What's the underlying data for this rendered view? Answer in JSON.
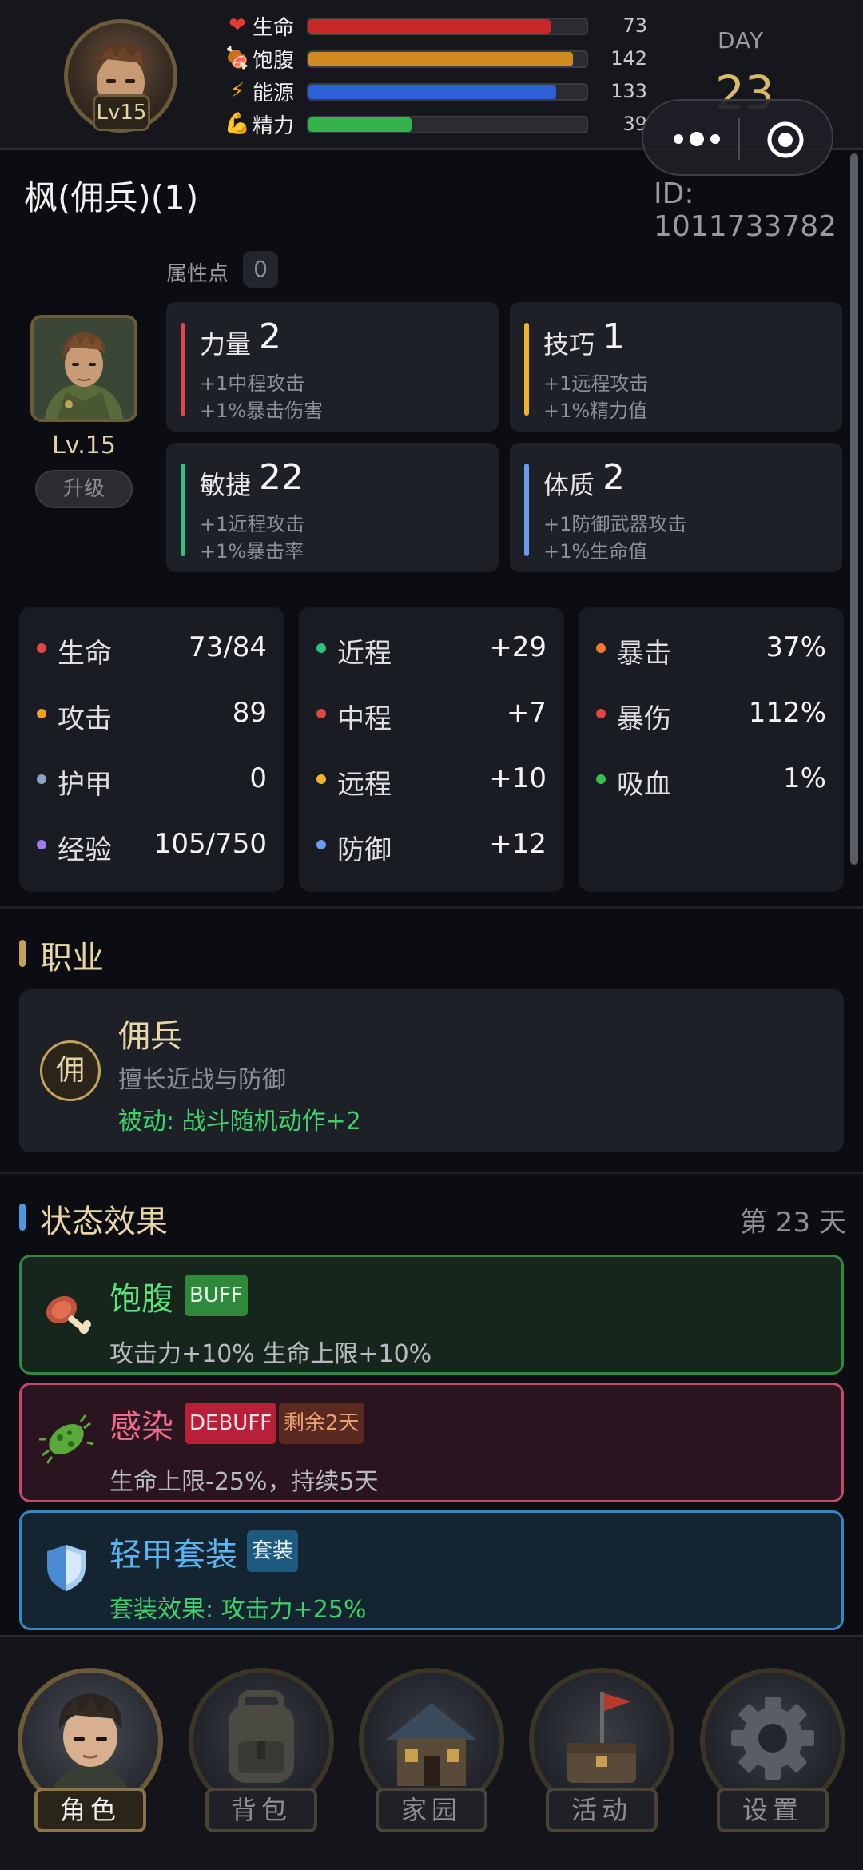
{
  "header": {
    "level_badge": "Lv15",
    "stats": [
      {
        "icon": "heart-icon",
        "glyph": "❤",
        "label": "生命",
        "value": "73",
        "fill": 0.87,
        "color": "#c62828"
      },
      {
        "icon": "meat-icon",
        "glyph": "🍖",
        "label": "饱腹",
        "value": "142",
        "fill": 0.95,
        "color": "#d08a1f"
      },
      {
        "icon": "lightning-icon",
        "glyph": "⚡",
        "label": "能源",
        "value": "133",
        "fill": 0.89,
        "color": "#2d5fd6"
      },
      {
        "icon": "muscle-icon",
        "glyph": "💪",
        "label": "精力",
        "value": "39",
        "fill": 0.37,
        "color": "#34b34a"
      }
    ],
    "day_label": "DAY",
    "day_number": "23"
  },
  "character": {
    "name": "枫(佣兵)(1)",
    "id": "ID: 1011733782",
    "attr_points_label": "属性点",
    "attr_points_value": "0",
    "level": "Lv.15",
    "upgrade_label": "升级"
  },
  "attributes": [
    {
      "name": "力量",
      "value": "2",
      "desc1": "+1中程攻击",
      "desc2": "+1%暴击伤害",
      "color": "#e04848"
    },
    {
      "name": "技巧",
      "value": "1",
      "desc1": "+1远程攻击",
      "desc2": "+1%精力值",
      "color": "#f0b429"
    },
    {
      "name": "敏捷",
      "value": "22",
      "desc1": "+1近程攻击",
      "desc2": "+1%暴击率",
      "color": "#2ec27e"
    },
    {
      "name": "体质",
      "value": "2",
      "desc1": "+1防御武器攻击",
      "desc2": "+1%生命值",
      "color": "#6a9cf0"
    }
  ],
  "stats_panels": [
    [
      {
        "name": "生命",
        "value": "73/84",
        "color": "#e04848"
      },
      {
        "name": "攻击",
        "value": "89",
        "color": "#f0a020"
      },
      {
        "name": "护甲",
        "value": "0",
        "color": "#8aa4c8"
      },
      {
        "name": "经验",
        "value": "105/750",
        "color": "#a07cf0"
      }
    ],
    [
      {
        "name": "近程",
        "value": "+29",
        "color": "#2ec27e"
      },
      {
        "name": "中程",
        "value": "+7",
        "color": "#e04848"
      },
      {
        "name": "远程",
        "value": "+10",
        "color": "#f0b429"
      },
      {
        "name": "防御",
        "value": "+12",
        "color": "#6a9cf0"
      }
    ],
    [
      {
        "name": "暴击",
        "value": "37%",
        "color": "#f07830"
      },
      {
        "name": "暴伤",
        "value": "112%",
        "color": "#e04848"
      },
      {
        "name": "吸血",
        "value": "1%",
        "color": "#34c04a"
      }
    ]
  ],
  "class_section": {
    "title": "职业",
    "icon_text": "佣",
    "name": "佣兵",
    "desc": "擅长近战与防御",
    "passive": "被动: 战斗随机动作+2"
  },
  "status_section": {
    "title": "状态效果",
    "day_count": "第 23 天",
    "effects": [
      {
        "icon": "meat-icon",
        "name": "饱腹",
        "tag": "BUFF",
        "desc": "攻击力+10%  生命上限+10%"
      },
      {
        "icon": "virus-icon",
        "name": "感染",
        "tag": "DEBUFF",
        "tag2": "剩余2天",
        "desc": "生命上限-25%，持续5天"
      },
      {
        "icon": "shield-icon",
        "name": "轻甲套装",
        "tag": "套装",
        "desc": "套装效果: 攻击力+25%"
      }
    ]
  },
  "nav": [
    {
      "label": "角色",
      "icon": "character-icon",
      "active": true
    },
    {
      "label": "背包",
      "icon": "backpack-icon",
      "active": false
    },
    {
      "label": "家园",
      "icon": "house-icon",
      "active": false
    },
    {
      "label": "活动",
      "icon": "flag-chest-icon",
      "active": false
    },
    {
      "label": "设置",
      "icon": "gear-icon",
      "active": false
    }
  ]
}
